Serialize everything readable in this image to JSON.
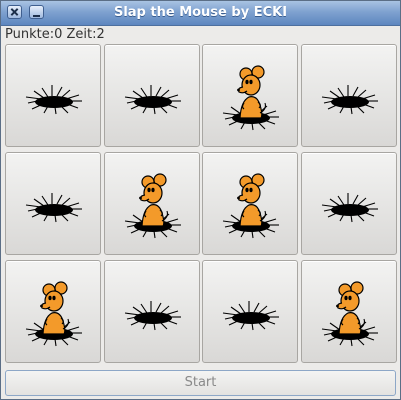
{
  "window": {
    "title": "Slap the Mouse by ECKI"
  },
  "status": {
    "text": "Punkte:0 Zeit:2"
  },
  "board": {
    "rows": 3,
    "cols": 4,
    "cells": [
      "hole",
      "hole",
      "mouse",
      "hole",
      "hole",
      "mouse",
      "mouse",
      "hole",
      "mouse",
      "hole",
      "hole",
      "mouse"
    ]
  },
  "start_button": {
    "label": "Start"
  }
}
